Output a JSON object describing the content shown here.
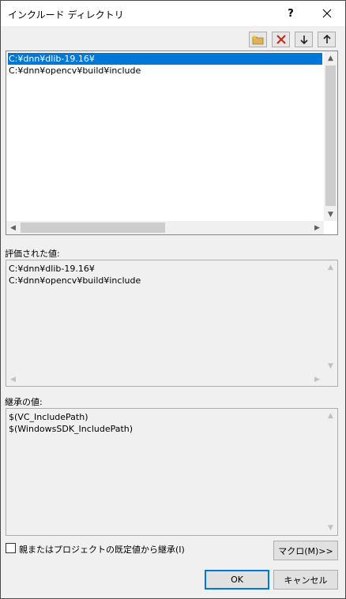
{
  "window": {
    "title": "インクルード ディレクトリ",
    "help_label": "?",
    "close_label": "✕"
  },
  "toolbar": {
    "new_line_icon": "new-folder-icon",
    "delete_icon": "delete-x-icon",
    "move_down_icon": "arrow-down-icon",
    "move_up_icon": "arrow-up-icon",
    "delete_color": "#c42b1c"
  },
  "editor": {
    "items": [
      "C:¥dnn¥dlib-19.16¥",
      "C:¥dnn¥opencv¥build¥include"
    ]
  },
  "evaluated": {
    "label": "評価された値:",
    "items": [
      "C:¥dnn¥dlib-19.16¥",
      "C:¥dnn¥opencv¥build¥include"
    ]
  },
  "inherited": {
    "label": "継承の値:",
    "items": [
      "$(VC_IncludePath)",
      "$(WindowsSDK_IncludePath)"
    ]
  },
  "options": {
    "inherit_checkbox_label": "親またはプロジェクトの既定値から継承(I)",
    "inherit_checked": false
  },
  "buttons": {
    "macro": "マクロ(M)>>",
    "ok": "OK",
    "cancel": "キャンセル"
  },
  "colors": {
    "selection": "#0078d7",
    "default_button_border": "#0078d7"
  }
}
